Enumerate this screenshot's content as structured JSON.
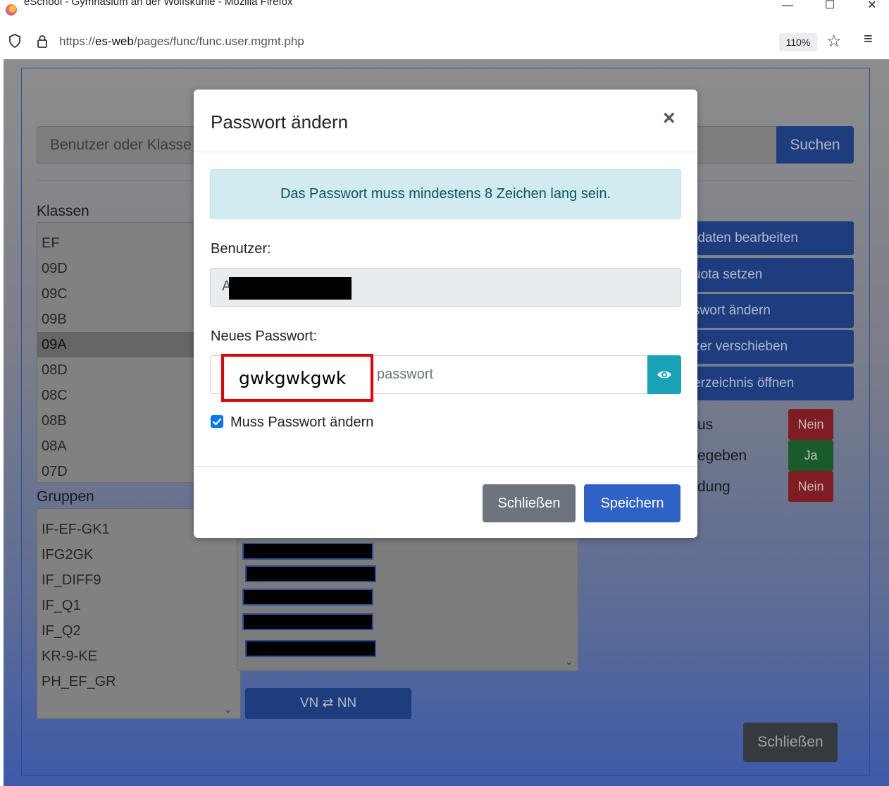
{
  "window": {
    "title": "eSchool - Gymnasium an der Wolfskuhle - Mozilla Firefox",
    "minimize": "—",
    "maximize": "☐",
    "close": "✕"
  },
  "urlbar": {
    "url_prefix": "https://",
    "url_host": "es-web",
    "url_path": "/pages/func/func.user.mgmt.php",
    "zoom": "110%"
  },
  "search": {
    "placeholder": "Benutzer oder Klasse",
    "button": "Suchen"
  },
  "classes": {
    "label": "Klassen",
    "items": [
      "EF",
      "09D",
      "09C",
      "09B",
      "09A",
      "08D",
      "08C",
      "08B",
      "08A",
      "07D"
    ],
    "selected": "09A"
  },
  "groups": {
    "label": "Gruppen",
    "items": [
      "IF-EF-GK1",
      "IFG2GK",
      "IF_DIFF9",
      "IF_Q1",
      "IF_Q2",
      "KR-9-KE",
      "PH_EF_GR"
    ]
  },
  "swap_button": "VN ⇄ NN",
  "actions": [
    "rdaten bearbeiten",
    "uota setzen",
    "swort ändern",
    "zer verschieben",
    "erzeichnis öffnen"
  ],
  "statuses": [
    {
      "label": "us",
      "value": "Nein"
    },
    {
      "label": "egeben",
      "value": "Ja"
    },
    {
      "label": "dung",
      "value": "Nein"
    }
  ],
  "page_close": "Schließen",
  "modal": {
    "title": "Passwort ändern",
    "close_x": "×",
    "alert": "Das Passwort muss mindestens 8 Zeichen lang sein.",
    "user_label": "Benutzer:",
    "user_value": "A",
    "password_label": "Neues Passwort:",
    "password_placeholder": "passwort",
    "password_value": "gwkgwkgwk",
    "must_change_label": "Muss Passwort ändern",
    "must_change_checked": true,
    "close_button": "Schließen",
    "save_button": "Speichern"
  },
  "colors": {
    "primary": "#2f62c6",
    "info": "#17a2b8",
    "secondary": "#6c757d",
    "alert_bg": "#d1ecf1",
    "highlight": "#e60000"
  }
}
